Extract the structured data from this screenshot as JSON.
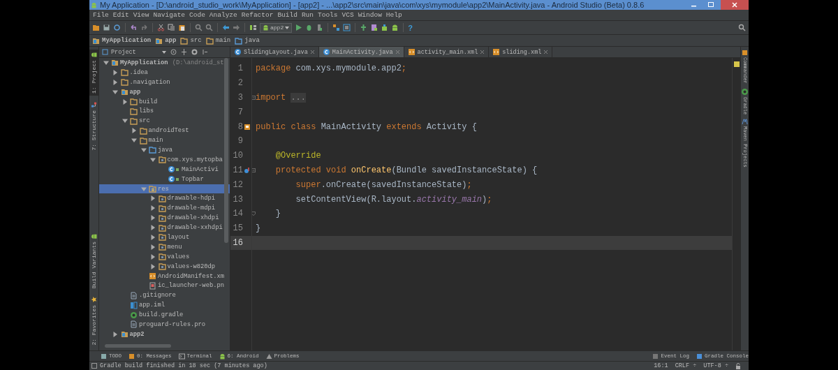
{
  "window": {
    "title": "My Application - [D:\\android_studio_work\\MyApplication] - [app2] - ...\\app2\\src\\main\\java\\com\\xys\\mymodule\\app2\\MainActivity.java - Android Studio (Beta) 0.8.6"
  },
  "menu": [
    "File",
    "Edit",
    "View",
    "Navigate",
    "Code",
    "Analyze",
    "Refactor",
    "Build",
    "Run",
    "Tools",
    "VCS",
    "Window",
    "Help"
  ],
  "toolbar": {
    "run_config": "app2",
    "help": "?"
  },
  "breadcrumbs": [
    {
      "label": "MyApplication",
      "kind": "module"
    },
    {
      "label": "app",
      "kind": "module"
    },
    {
      "label": "src",
      "kind": "folder"
    },
    {
      "label": "main",
      "kind": "folder"
    },
    {
      "label": "java",
      "kind": "source"
    }
  ],
  "left_strip": {
    "top": [
      {
        "label": "1: Project",
        "selected": true
      },
      {
        "label": "7: Structure",
        "selected": false
      }
    ],
    "bottom": [
      {
        "label": "Build Variants",
        "selected": false
      },
      {
        "label": "2: Favorites",
        "selected": false
      }
    ]
  },
  "right_strip": [
    {
      "label": "Commander"
    },
    {
      "label": "Gradle"
    },
    {
      "label": "Maven Projects"
    }
  ],
  "project": {
    "view": "Project",
    "tree": [
      {
        "label": "MyApplication",
        "hint": "(D:\\android_st",
        "kind": "module",
        "expanded": true,
        "selected": false,
        "children": [
          {
            "label": ".idea",
            "kind": "folder",
            "expanded": false,
            "selected": false
          },
          {
            "label": ".navigation",
            "kind": "folder",
            "expanded": false,
            "selected": false
          },
          {
            "label": "app",
            "kind": "module",
            "expanded": true,
            "selected": false,
            "children": [
              {
                "label": "build",
                "kind": "folder",
                "expanded": false,
                "selected": false
              },
              {
                "label": "libs",
                "kind": "folder",
                "selected": false
              },
              {
                "label": "src",
                "kind": "folder",
                "expanded": true,
                "selected": false,
                "children": [
                  {
                    "label": "androidTest",
                    "kind": "folder",
                    "expanded": false,
                    "selected": false
                  },
                  {
                    "label": "main",
                    "kind": "folder",
                    "expanded": true,
                    "selected": false,
                    "children": [
                      {
                        "label": "java",
                        "kind": "source",
                        "expanded": true,
                        "selected": false,
                        "children": [
                          {
                            "label": "com.xys.mytopba",
                            "kind": "package",
                            "expanded": true,
                            "selected": false,
                            "children": [
                              {
                                "label": "MainActivi",
                                "kind": "class",
                                "selected": false
                              },
                              {
                                "label": "Topbar",
                                "kind": "class",
                                "selected": false
                              }
                            ]
                          }
                        ]
                      },
                      {
                        "label": "res",
                        "kind": "resources",
                        "expanded": true,
                        "selected": true,
                        "children": [
                          {
                            "label": "drawable-hdpi",
                            "kind": "package",
                            "expanded": false,
                            "selected": false
                          },
                          {
                            "label": "drawable-mdpi",
                            "kind": "package",
                            "expanded": false,
                            "selected": false
                          },
                          {
                            "label": "drawable-xhdpi",
                            "kind": "package",
                            "expanded": false,
                            "selected": false
                          },
                          {
                            "label": "drawable-xxhdpi",
                            "kind": "package",
                            "expanded": false,
                            "selected": false
                          },
                          {
                            "label": "layout",
                            "kind": "package",
                            "expanded": false,
                            "selected": false
                          },
                          {
                            "label": "menu",
                            "kind": "package",
                            "expanded": false,
                            "selected": false
                          },
                          {
                            "label": "values",
                            "kind": "package",
                            "expanded": false,
                            "selected": false
                          },
                          {
                            "label": "values-w820dp",
                            "kind": "package",
                            "expanded": false,
                            "selected": false
                          }
                        ]
                      },
                      {
                        "label": "AndroidManifest.xm",
                        "kind": "xml",
                        "selected": false
                      },
                      {
                        "label": "ic_launcher-web.pn",
                        "kind": "image",
                        "selected": false
                      }
                    ]
                  }
                ]
              },
              {
                "label": ".gitignore",
                "kind": "file",
                "selected": false
              },
              {
                "label": "app.iml",
                "kind": "iml",
                "selected": false
              },
              {
                "label": "build.gradle",
                "kind": "gradle",
                "selected": false
              },
              {
                "label": "proguard-rules.pro",
                "kind": "file",
                "selected": false
              }
            ]
          },
          {
            "label": "app2",
            "kind": "module",
            "expanded": false,
            "selected": false
          }
        ]
      }
    ]
  },
  "editor": {
    "tabs": [
      {
        "label": "SlidingLayout.java",
        "kind": "class",
        "selected": false
      },
      {
        "label": "MainActivity.java",
        "kind": "class",
        "selected": true
      },
      {
        "label": "activity_main.xml",
        "kind": "xml",
        "selected": false
      },
      {
        "label": "sliding.xml",
        "kind": "xml",
        "selected": false
      }
    ],
    "lines": [
      {
        "number": "1",
        "current": false,
        "tokens": [
          {
            "text": "package ",
            "kind": "keyword"
          },
          {
            "text": "com.xys.mymodule.app2",
            "kind": "plain"
          },
          {
            "text": ";",
            "kind": "punct"
          }
        ]
      },
      {
        "number": "2",
        "current": false
      },
      {
        "number": "3",
        "current": false,
        "tokens": [
          {
            "text": "import ",
            "kind": "keyword"
          },
          {
            "text": "...",
            "kind": "folded"
          }
        ]
      },
      {
        "number": "7",
        "current": false
      },
      {
        "number": "8",
        "current": false,
        "tokens": [
          {
            "text": "public class ",
            "kind": "keyword"
          },
          {
            "text": "MainActivity ",
            "kind": "plain"
          },
          {
            "text": "extends ",
            "kind": "keyword"
          },
          {
            "text": "Activity {",
            "kind": "plain"
          }
        ]
      },
      {
        "number": "9",
        "current": false
      },
      {
        "number": "10",
        "current": false,
        "tokens": [
          {
            "text": "    @Override",
            "kind": "annotation"
          }
        ]
      },
      {
        "number": "11",
        "current": false,
        "tokens": [
          {
            "text": "    protected void ",
            "kind": "keyword"
          },
          {
            "text": "onCreate",
            "kind": "method"
          },
          {
            "text": "(Bundle savedInstanceState) {",
            "kind": "plain"
          }
        ]
      },
      {
        "number": "12",
        "current": false,
        "tokens": [
          {
            "text": "        super",
            "kind": "keyword"
          },
          {
            "text": ".onCreate(savedInstanceState)",
            "kind": "plain"
          },
          {
            "text": ";",
            "kind": "punct"
          }
        ]
      },
      {
        "number": "13",
        "current": false,
        "tokens": [
          {
            "text": "        setContentView(R.layout.",
            "kind": "plain"
          },
          {
            "text": "activity_main",
            "kind": "field"
          },
          {
            "text": ")",
            "kind": "plain"
          },
          {
            "text": ";",
            "kind": "punct"
          }
        ]
      },
      {
        "number": "14",
        "current": false,
        "tokens": [
          {
            "text": "    }",
            "kind": "plain"
          }
        ]
      },
      {
        "number": "15",
        "current": false,
        "tokens": [
          {
            "text": "}",
            "kind": "plain"
          }
        ]
      },
      {
        "number": "16",
        "current": true
      }
    ]
  },
  "tool_tabs": {
    "left": [
      {
        "label": "TODO"
      },
      {
        "label": "0: Messages"
      },
      {
        "label": "Terminal"
      },
      {
        "label": "6: Android"
      },
      {
        "label": "Problems"
      }
    ],
    "right": [
      {
        "label": "Event Log"
      },
      {
        "label": "Gradle Console"
      }
    ]
  },
  "status_bar": {
    "message": "Gradle build finished in 18 sec (7 minutes ago)",
    "position": "16:1",
    "line_separator": "CRLF ÷",
    "encoding": "UTF-8 ÷"
  }
}
